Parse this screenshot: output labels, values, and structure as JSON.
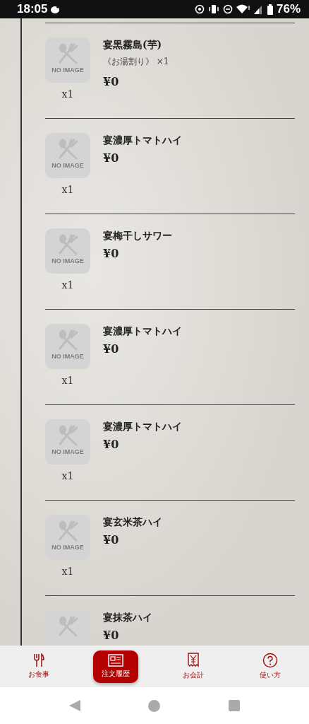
{
  "status_bar": {
    "time": "18:05",
    "battery": "76%"
  },
  "items": [
    {
      "name": "宴黒霧島(芋)",
      "option": "《お湯割り》 ×1",
      "price": "¥0",
      "quantity": "x1",
      "no_image_label": "NO IMAGE"
    },
    {
      "name": "宴濃厚トマトハイ",
      "price": "¥0",
      "quantity": "x1",
      "no_image_label": "NO IMAGE"
    },
    {
      "name": "宴梅干しサワー",
      "price": "¥0",
      "quantity": "x1",
      "no_image_label": "NO IMAGE"
    },
    {
      "name": "宴濃厚トマトハイ",
      "price": "¥0",
      "quantity": "x1",
      "no_image_label": "NO IMAGE"
    },
    {
      "name": "宴濃厚トマトハイ",
      "price": "¥0",
      "quantity": "x1",
      "no_image_label": "NO IMAGE"
    },
    {
      "name": "宴玄米茶ハイ",
      "price": "¥0",
      "quantity": "x1",
      "no_image_label": "NO IMAGE"
    },
    {
      "name": "宴抹茶ハイ",
      "price": "¥0"
    }
  ],
  "tabs": [
    {
      "kind": "food",
      "label": "お食事",
      "selected": false
    },
    {
      "kind": "history",
      "label": "注文履歴",
      "selected": true
    },
    {
      "kind": "bill",
      "label": "お会計",
      "selected": false
    },
    {
      "kind": "help",
      "label": "使い方",
      "selected": false
    }
  ]
}
